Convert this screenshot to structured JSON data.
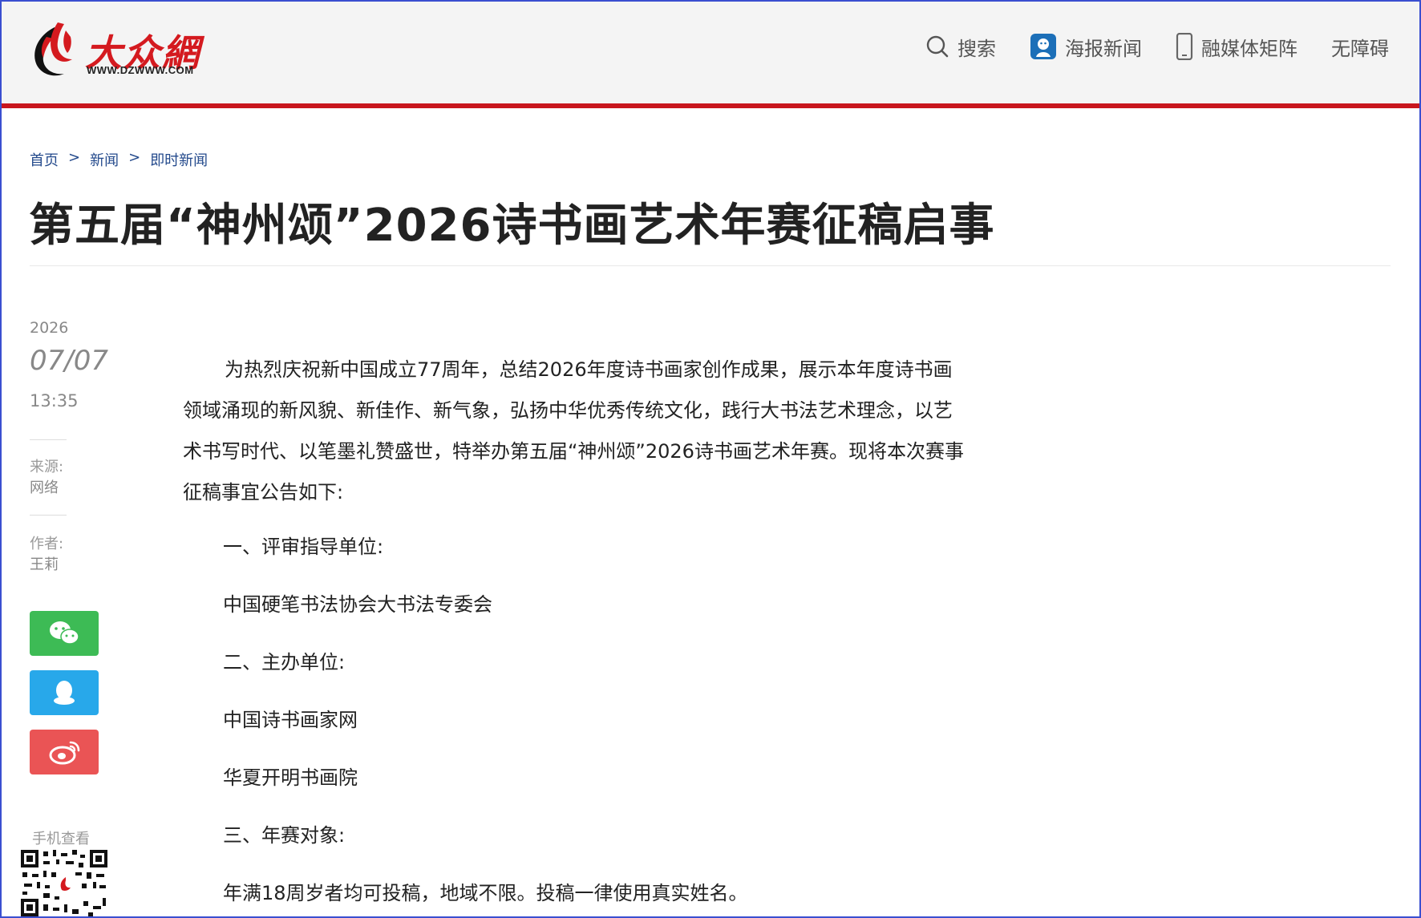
{
  "header": {
    "logo_text": "大众網",
    "logo_url": "WWW.DZWWW.COM",
    "nav": [
      {
        "label": "搜索",
        "icon": "search-icon"
      },
      {
        "label": "海报新闻",
        "icon": "poster-news-icon"
      },
      {
        "label": "融媒体矩阵",
        "icon": "mobile-phone-icon"
      },
      {
        "label": "无障碍",
        "icon": ""
      }
    ]
  },
  "breadcrumb": [
    "首页",
    "新闻",
    "即时新闻"
  ],
  "breadcrumb_sep": ">",
  "article": {
    "title": "第五届“神州颂”2026诗书画艺术年赛征稿启事",
    "year": "2026",
    "date": "07/07",
    "time": "13:35",
    "source_label": "来源:",
    "source": "网络",
    "author_label": "作者:",
    "author": "王莉",
    "lead_lines": [
      "为热烈庆祝新中国成立77周年，总结2026年度诗书画家创作成果，展示本年度诗",
      "书画领域涌现的新风貌、新佳作、新气象，弘扬中华优秀传统文化，践行大书法艺术理",
      "念，以艺术书写时代、以笔墨礼赞盛世，特举办第五届“神州颂”2026诗书画艺术年",
      "赛。现将本次赛事征稿事宜公告如下:"
    ],
    "paragraphs": [
      "一、评审指导单位:",
      "中国硬笔书法协会大书法专委会",
      "二、主办单位:",
      "中国诗书画家网",
      "华夏开明书画院",
      "三、年赛对象:",
      "年满18周岁者均可投稿，地域不限。投稿一律使用真实姓名。"
    ]
  },
  "share": {
    "wechat": "wechat-icon",
    "qq": "qq-icon",
    "weibo": "weibo-icon"
  },
  "mobile_label": "手机查看",
  "colors": {
    "brand_red": "#c8161d",
    "link_blue": "#244a8c",
    "wechat_green": "#3dbb55",
    "qq_blue": "#28a8ea",
    "weibo_red": "#ea5455"
  }
}
